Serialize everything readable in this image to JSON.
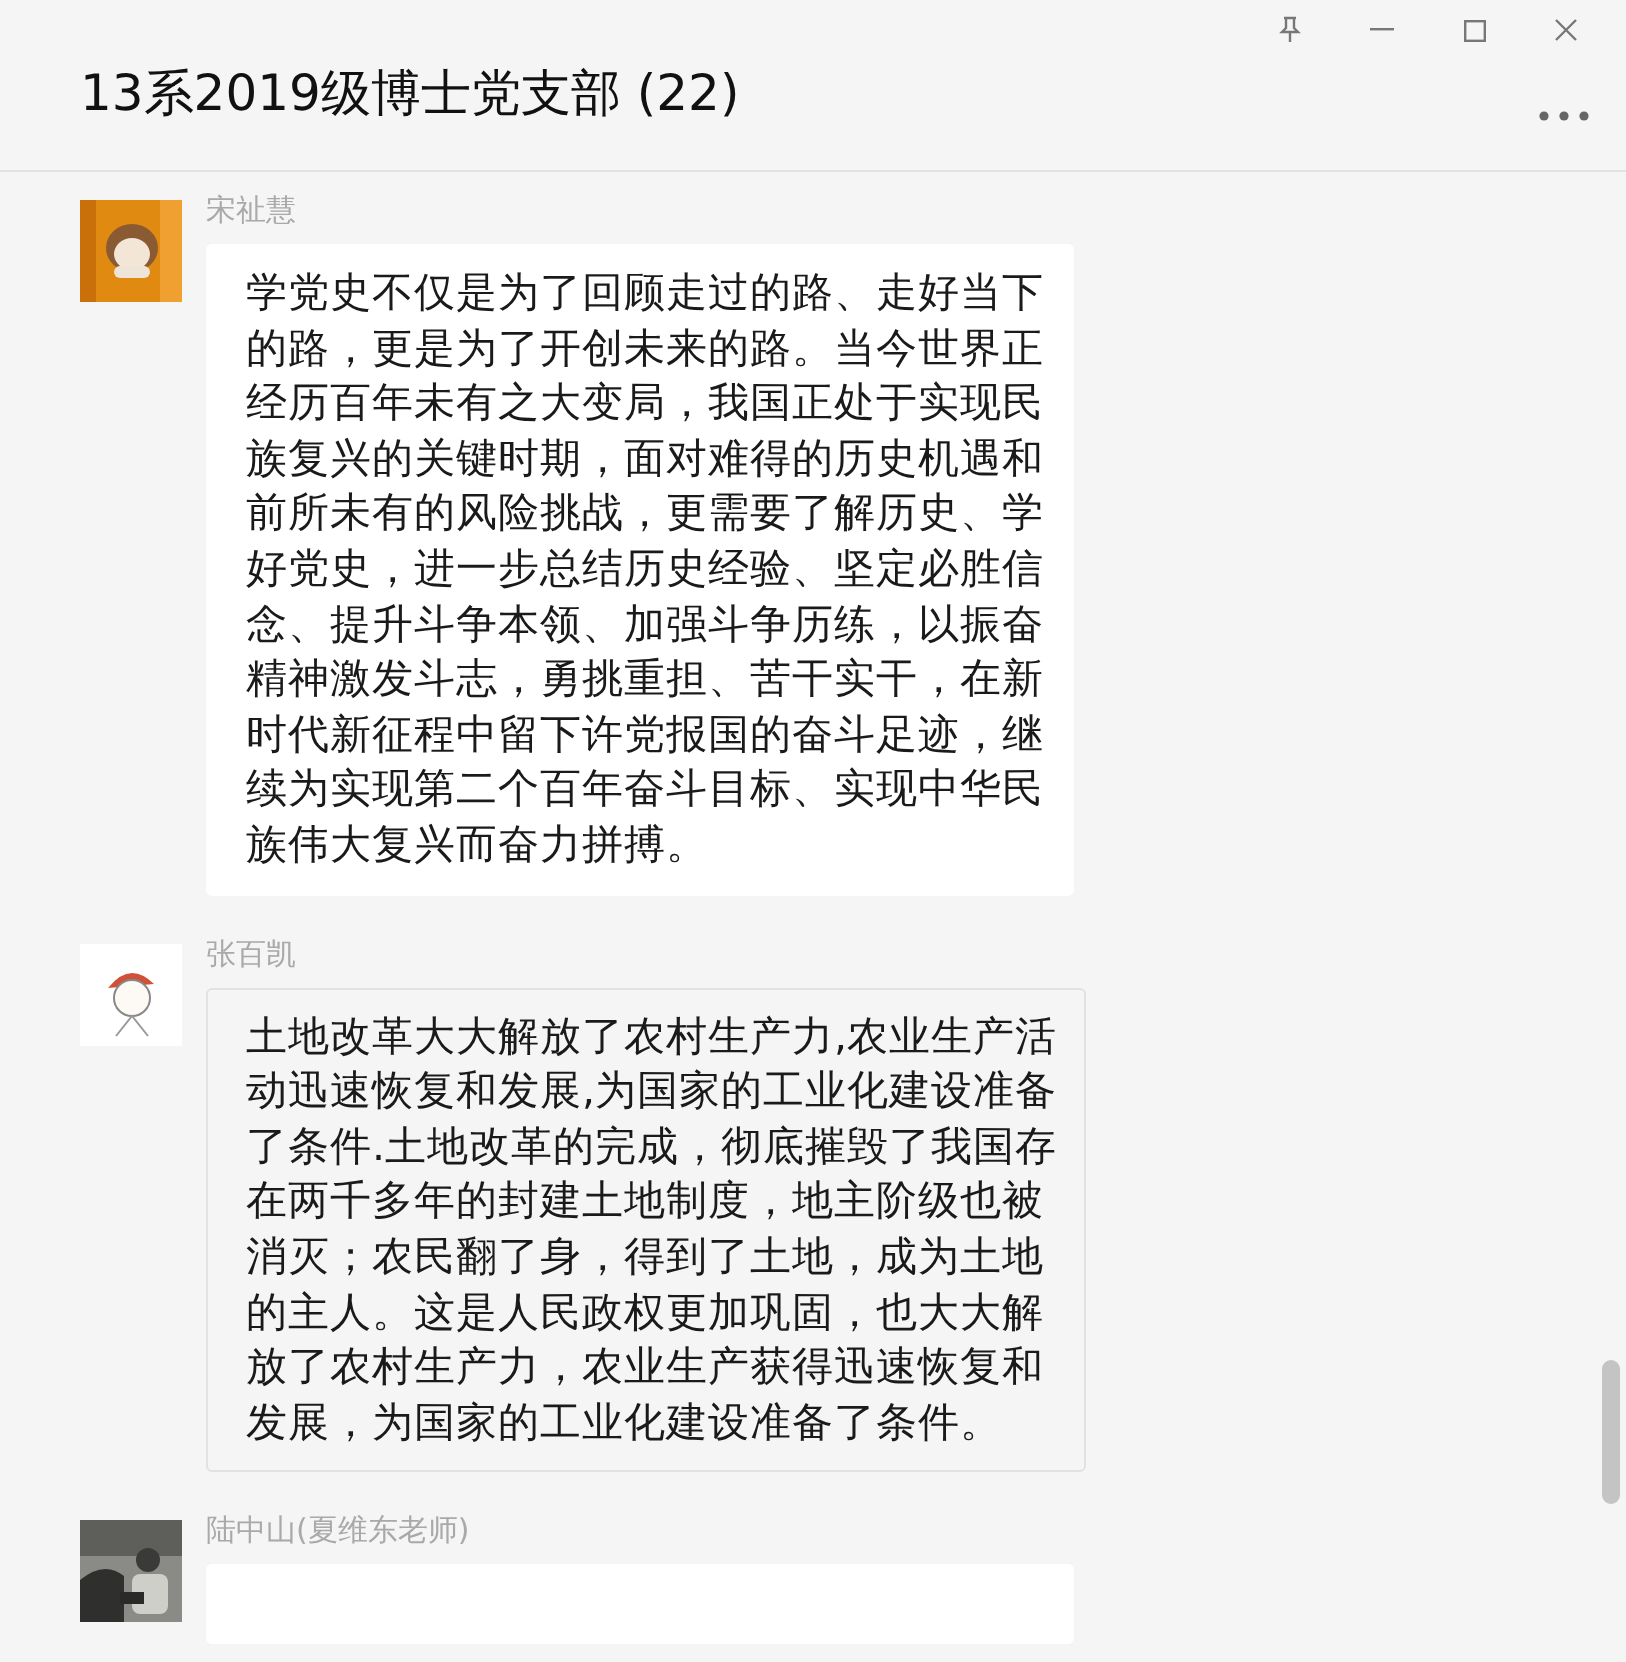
{
  "window": {
    "title": "13系2019级博士党支部 (22)"
  },
  "messages": [
    {
      "sender": "宋祉慧",
      "kind": "white",
      "text": "学党史不仅是为了回顾走过的路、走好当下的路，更是为了开创未来的路。当今世界正经历百年未有之大变局，我国正处于实现民族复兴的关键时期，面对难得的历史机遇和前所未有的风险挑战，更需要了解历史、学好党史，进一步总结历史经验、坚定必胜信念、提升斗争本领、加强斗争历练，以振奋精神激发斗志，勇挑重担、苦干实干，在新时代新征程中留下许党报国的奋斗足迹，继续为实现第二个百年奋斗目标、实现中华民族伟大复兴而奋力拼搏。"
    },
    {
      "sender": "张百凯",
      "kind": "outlined",
      "text": "土地改革大大解放了农村生产力,农业生产活动迅速恢复和发展,为国家的工业化建设准备了条件.土地改革的完成，彻底摧毁了我国存在两千多年的封建土地制度，地主阶级也被消灭；农民翻了身，得到了土地，成为土地的主人。这是人民政权更加巩固，也大大解放了农村生产力，农业生产获得迅速恢复和发展，为国家的工业化建设准备了条件。"
    },
    {
      "sender": "陆中山(夏维东老师)",
      "kind": "white"
    }
  ]
}
